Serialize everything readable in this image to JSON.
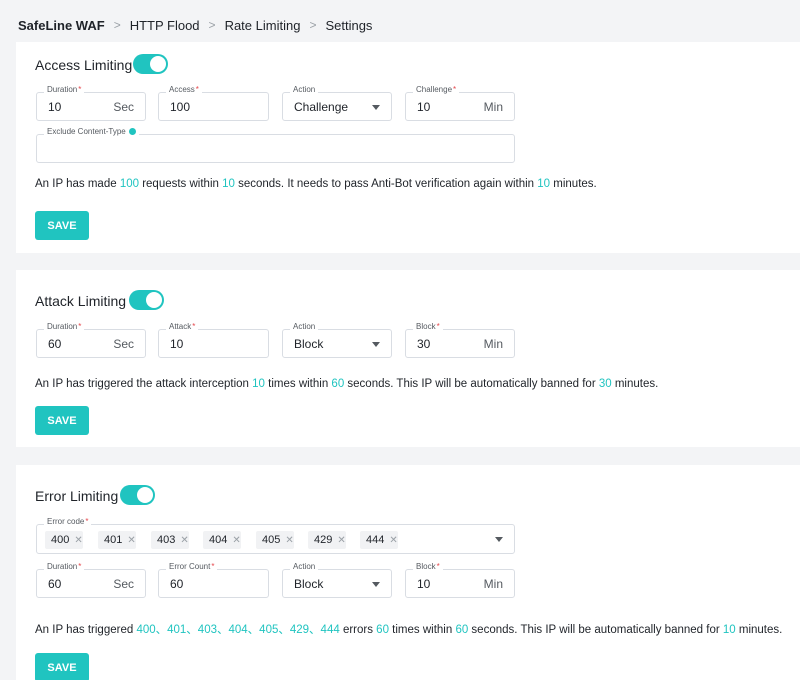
{
  "breadcrumb": [
    "SafeLine WAF",
    "HTTP Flood",
    "Rate Limiting",
    "Settings"
  ],
  "access_limiting": {
    "title": "Access Limiting",
    "enabled": true,
    "duration": {
      "label": "Duration",
      "value": "10",
      "unit": "Sec"
    },
    "access": {
      "label": "Access",
      "value": "100"
    },
    "action": {
      "label": "Action",
      "value": "Challenge"
    },
    "challenge": {
      "label": "Challenge",
      "value": "10",
      "unit": "Min"
    },
    "exclude": {
      "label": "Exclude Content-Type",
      "value": ""
    },
    "desc": {
      "p1": "An IP has made ",
      "n1": "100",
      "p2": " requests within ",
      "n2": "10",
      "p3": " seconds. It needs to pass Anti-Bot verification again within ",
      "n3": "10",
      "p4": " minutes."
    },
    "save": "SAVE"
  },
  "attack_limiting": {
    "title": "Attack Limiting",
    "enabled": true,
    "duration": {
      "label": "Duration",
      "value": "60",
      "unit": "Sec"
    },
    "attack": {
      "label": "Attack",
      "value": "10"
    },
    "action": {
      "label": "Action",
      "value": "Block"
    },
    "block": {
      "label": "Block",
      "value": "30",
      "unit": "Min"
    },
    "desc": {
      "p1": "An IP has triggered the attack interception ",
      "n1": "10",
      "p2": " times within ",
      "n2": "60",
      "p3": " seconds. This IP will be automatically banned for ",
      "n3": "30",
      "p4": " minutes."
    },
    "save": "SAVE"
  },
  "error_limiting": {
    "title": "Error Limiting",
    "enabled": true,
    "error_code": {
      "label": "Error code",
      "tags": [
        "400",
        "401",
        "403",
        "404",
        "405",
        "429",
        "444"
      ]
    },
    "duration": {
      "label": "Duration",
      "value": "60",
      "unit": "Sec"
    },
    "error_count": {
      "label": "Error Count",
      "value": "60"
    },
    "action": {
      "label": "Action",
      "value": "Block"
    },
    "block": {
      "label": "Block",
      "value": "10",
      "unit": "Min"
    },
    "desc": {
      "p1": "An IP has triggered ",
      "codes": "400、401、403、404、405、429、444",
      "p2": " errors ",
      "n1": "60",
      "p3": " times within ",
      "n2": "60",
      "p4": " seconds. This IP will be automatically banned for ",
      "n3": "10",
      "p5": " minutes."
    },
    "save": "SAVE"
  },
  "colors": {
    "accent": "#20c4c0",
    "required": "#e5484d"
  }
}
